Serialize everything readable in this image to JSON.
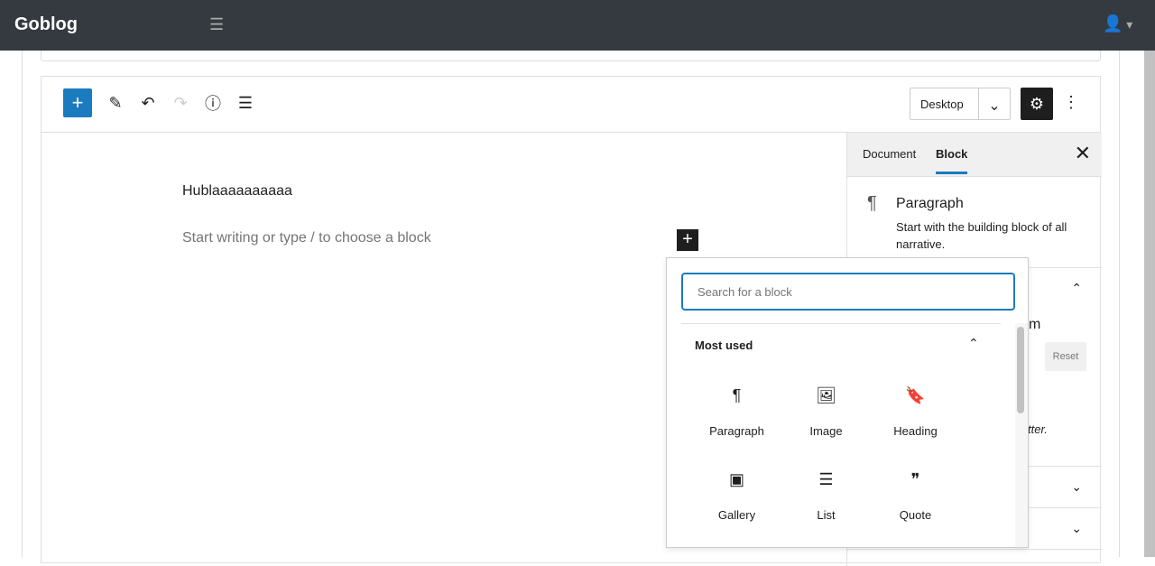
{
  "app": {
    "title": "Goblog",
    "menu_icon": "hamburger-icon",
    "user_icon": "user-icon"
  },
  "toolbar": {
    "device": "Desktop"
  },
  "editor": {
    "title": "Hublaaaaaaaaaa",
    "placeholder": "Start writing or type / to choose a block"
  },
  "sidebar": {
    "tabs": [
      {
        "label": "Document"
      },
      {
        "label": "Block",
        "active": true
      }
    ],
    "block": {
      "name": "Paragraph",
      "description": "Start with the building block of all narrative."
    },
    "partial_text": {
      "m": "m",
      "reset": "Reset",
      "tter": "tter."
    }
  },
  "inserter": {
    "search_placeholder": "Search for a block",
    "section": "Most used",
    "items": [
      {
        "label": "Paragraph",
        "icon": "¶"
      },
      {
        "label": "Image",
        "icon": "🖼"
      },
      {
        "label": "Heading",
        "icon": "🔖"
      },
      {
        "label": "Gallery",
        "icon": "▣"
      },
      {
        "label": "List",
        "icon": "☰"
      },
      {
        "label": "Quote",
        "icon": "❞"
      }
    ]
  },
  "colors": {
    "accent": "#1a7bbf",
    "topbar": "#343a40"
  }
}
